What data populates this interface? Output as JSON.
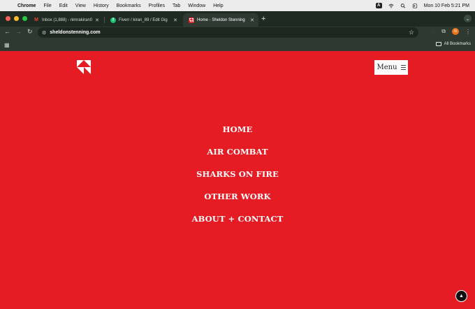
{
  "menubar": {
    "app": "Chrome",
    "items": [
      "File",
      "Edit",
      "View",
      "History",
      "Bookmarks",
      "Profiles",
      "Tab",
      "Window",
      "Help"
    ],
    "input_badge": "A",
    "datetime": "Mon 10 Feb  5:21 PM"
  },
  "tabs": [
    {
      "title": "Inbox (1,888) - nimrakiran0",
      "favicon": "gmail-icon"
    },
    {
      "title": "Fiverr / kiran_89 / Edit Gig",
      "favicon": "fiverr-icon"
    },
    {
      "title": "Home - Sheldon Stenning",
      "favicon": "site-logo-icon"
    }
  ],
  "toolbar": {
    "url": "sheldonstenning.com",
    "profile_initial": "N"
  },
  "bookmarks": {
    "all_label": "All Bookmarks"
  },
  "page": {
    "menu_label": "Menu",
    "nav": [
      "HOME",
      "AIR COMBAT",
      "SHARKS ON FIRE",
      "OTHER WORK",
      "ABOUT + CONTACT"
    ]
  },
  "colors": {
    "page_bg": "#e61c24",
    "chrome_frame": "#2e3a31",
    "tab_strip": "#1f2b22"
  }
}
